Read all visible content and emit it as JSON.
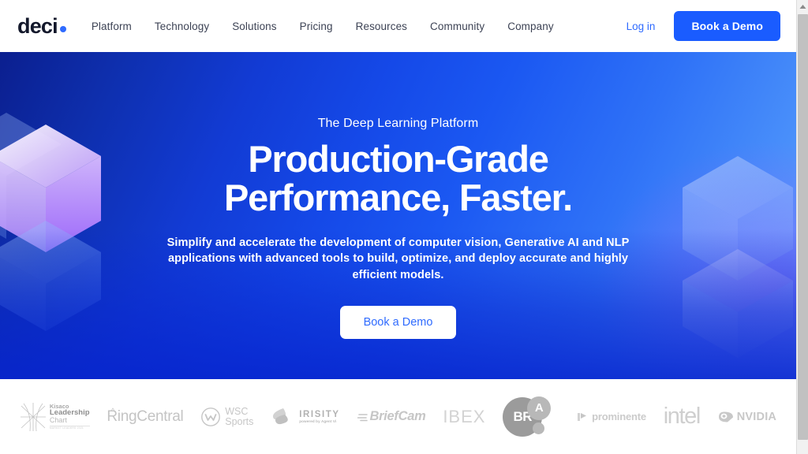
{
  "nav": {
    "logo_text": "deci",
    "logo_dot_icon": "circle-dot-icon",
    "links": [
      {
        "label": "Platform"
      },
      {
        "label": "Technology"
      },
      {
        "label": "Solutions"
      },
      {
        "label": "Pricing"
      },
      {
        "label": "Resources"
      },
      {
        "label": "Community"
      },
      {
        "label": "Company"
      }
    ],
    "login_label": "Log in",
    "demo_label": "Book a Demo"
  },
  "hero": {
    "eyebrow": "The Deep Learning Platform",
    "headline_line1": "Production-Grade",
    "headline_line2": "Performance, Faster.",
    "subhead": "Simplify and accelerate the development of computer vision, Generative AI and NLP applications with advanced tools to build, optimize, and deploy accurate and highly efficient models.",
    "cta_label": "Book a Demo",
    "decor_left_icon": "isometric-cube-stack-icon",
    "decor_right_icon": "isometric-cube-stack-icon",
    "colors": {
      "gradient_start": "#0b1f8f",
      "gradient_end": "#5ba3fb",
      "purple_glow": "#965aff",
      "cube_highlight": "#d8b6ff"
    }
  },
  "logos": {
    "kisaco": {
      "line1": "Kisaco",
      "line2": "Leadership",
      "line3": "Chart",
      "line4": "MARKET LEADERS 2021",
      "mark_icon": "starburst-icon"
    },
    "ringcentral": {
      "label": "RingCentral",
      "mark_icon": "caret-accent-icon"
    },
    "wsc": {
      "line1": "WSC",
      "line2": "Sports",
      "mark_icon": "circle-w-icon"
    },
    "irisity": {
      "label": "IRISITY",
      "tagline": "powered by Agent Vi",
      "mark_icon": "petal-swoosh-icon"
    },
    "briefcam": {
      "label": "BriefCam",
      "mark_icon": "speed-lines-icon"
    },
    "ibex": {
      "label": "IBEX"
    },
    "bra": {
      "label": "BR",
      "accent": "A",
      "mark_icon": "circle-badge-icon"
    },
    "prominente": {
      "label": "prominente",
      "mark_icon": "play-flag-icon"
    },
    "intel": {
      "label": "intel"
    },
    "nvidia": {
      "label": "NVIDIA",
      "mark_icon": "nvidia-eye-icon"
    }
  },
  "browser": {
    "scroll_up_icon": "scroll-up-arrow-icon",
    "scrollbar_thumb_color": "#c1c1c1"
  },
  "theme": {
    "brand_blue": "#1a5cff",
    "link_blue": "#2f6bff",
    "logo_navy": "#13182b",
    "logo_gray": "#c9c9cd"
  }
}
